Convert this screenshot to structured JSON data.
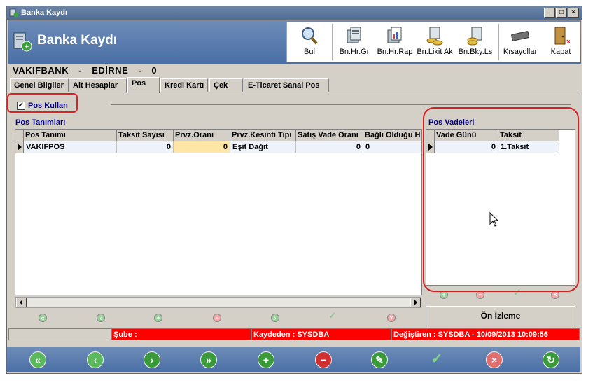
{
  "window": {
    "title": "Banka Kaydı"
  },
  "header": {
    "title": "Banka Kaydı"
  },
  "toolbar": {
    "bul": "Bul",
    "bnhrgr": "Bn.Hr.Gr",
    "bnhrrap": "Bn.Hr.Rap",
    "bnlikitak": "Bn.Likit Ak",
    "bnbkyls": "Bn.Bky.Ls",
    "kisayollar": "Kısayollar",
    "kapat": "Kapat"
  },
  "info": {
    "bank": "VAKIFBANK",
    "sep1": "-",
    "city": "EDİRNE",
    "sep2": "-",
    "num": "0"
  },
  "tabs": [
    "Genel Bilgiler",
    "Alt Hesaplar",
    "Pos",
    "Kredi Kartı",
    "Çek",
    "E-Ticaret Sanal Pos"
  ],
  "pos_kullan": {
    "label": "Pos Kullan",
    "checked": true
  },
  "pos_tanimlari": {
    "title": "Pos Tanımları",
    "columns": [
      "Pos Tanımı",
      "Taksit Sayısı",
      "Prvz.Oranı",
      "Prvz.Kesinti Tipi",
      "Satış Vade Oranı",
      "Bağlı Olduğu H"
    ],
    "rows": [
      [
        "VAKIFPOS",
        "0",
        "0",
        "Eşit Dağıt",
        "0",
        "0"
      ]
    ]
  },
  "pos_vadeleri": {
    "title": "Pos Vadeleri",
    "columns": [
      "Vade Günü",
      "Taksit"
    ],
    "rows": [
      [
        "0",
        "1.Taksit"
      ]
    ]
  },
  "on_izleme": "Ön İzleme",
  "status": {
    "sube": "Şube :",
    "kaydeden": "Kaydeden : SYSDBA",
    "degistiren": "Değiştiren : SYSDBA - 10/09/2013 10:09:56"
  },
  "colors": {
    "status_red": "#ff0000",
    "header_blue": "#4a6fa5"
  }
}
